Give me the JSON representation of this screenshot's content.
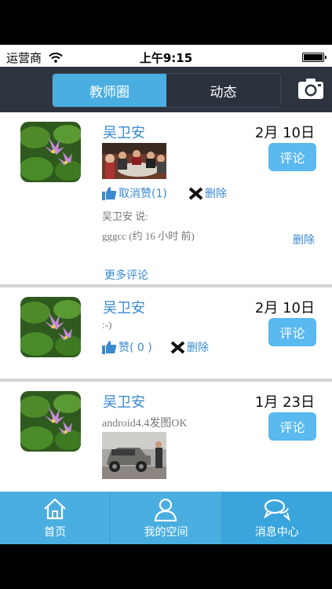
{
  "status_bar": {
    "carrier": "运营商",
    "time": "上午9:15"
  },
  "nav": {
    "tabs": [
      {
        "label": "教师圈",
        "active": true
      },
      {
        "label": "动态",
        "active": false
      }
    ],
    "camera_icon": "camera-icon"
  },
  "posts": [
    {
      "author": "吴卫安",
      "date": "2月 10日",
      "comment_button": "评论",
      "like_label": "取消赞(1)",
      "delete_label": "删除",
      "comment_author_line": "吴卫安 说:",
      "comment_text": "gggcc (约 16 小时 前)",
      "comment_delete": "删除",
      "more_comments": "更多评论"
    },
    {
      "author": "吴卫安",
      "date": "2月 10日",
      "comment_button": "评论",
      "content": ":-)",
      "like_label": "赞( 0 )",
      "delete_label": "删除"
    },
    {
      "author": "吴卫安",
      "date": "1月 23日",
      "comment_button": "评论",
      "content": "android4.4发图OK"
    }
  ],
  "tabbar": [
    {
      "label": "首页",
      "icon": "home-icon"
    },
    {
      "label": "我的空间",
      "icon": "user-icon"
    },
    {
      "label": "消息中心",
      "icon": "chat-icon",
      "selected": true
    }
  ],
  "colors": {
    "accent": "#4aaee1",
    "navbar": "#2d3440",
    "link": "#3a8ad0"
  }
}
